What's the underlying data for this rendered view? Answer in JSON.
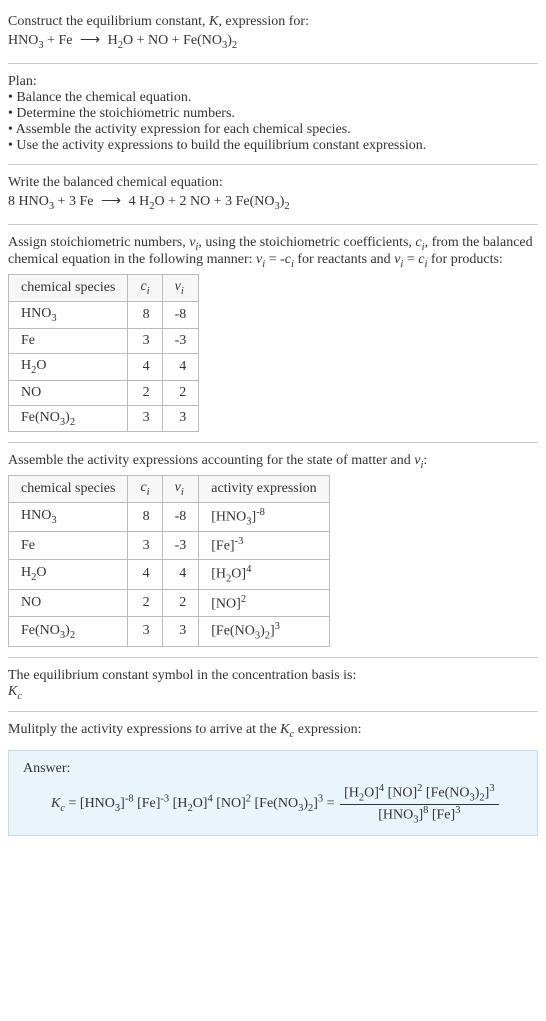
{
  "prompt": {
    "line1": "Construct the equilibrium constant, K, expression for:",
    "eq_lhs": "HNO₃ + Fe",
    "eq_rhs": "H₂O + NO + Fe(NO₃)₂"
  },
  "plan": {
    "title": "Plan:",
    "items": [
      "Balance the chemical equation.",
      "Determine the stoichiometric numbers.",
      "Assemble the activity expression for each chemical species.",
      "Use the activity expressions to build the equilibrium constant expression."
    ]
  },
  "balanced": {
    "title": "Write the balanced chemical equation:",
    "eq_lhs": "8 HNO₃ + 3 Fe",
    "eq_rhs": "4 H₂O + 2 NO + 3 Fe(NO₃)₂"
  },
  "stoich": {
    "intro": "Assign stoichiometric numbers, νᵢ, using the stoichiometric coefficients, cᵢ, from the balanced chemical equation in the following manner: νᵢ = -cᵢ for reactants and νᵢ = cᵢ for products:",
    "headers": [
      "chemical species",
      "cᵢ",
      "νᵢ"
    ],
    "rows": [
      {
        "species": "HNO₃",
        "ci": "8",
        "vi": "-8"
      },
      {
        "species": "Fe",
        "ci": "3",
        "vi": "-3"
      },
      {
        "species": "H₂O",
        "ci": "4",
        "vi": "4"
      },
      {
        "species": "NO",
        "ci": "2",
        "vi": "2"
      },
      {
        "species": "Fe(NO₃)₂",
        "ci": "3",
        "vi": "3"
      }
    ]
  },
  "activity": {
    "intro": "Assemble the activity expressions accounting for the state of matter and νᵢ:",
    "headers": [
      "chemical species",
      "cᵢ",
      "νᵢ",
      "activity expression"
    ],
    "rows": [
      {
        "species": "HNO₃",
        "ci": "8",
        "vi": "-8",
        "expr": "[HNO₃]⁻⁸"
      },
      {
        "species": "Fe",
        "ci": "3",
        "vi": "-3",
        "expr": "[Fe]⁻³"
      },
      {
        "species": "H₂O",
        "ci": "4",
        "vi": "4",
        "expr": "[H₂O]⁴"
      },
      {
        "species": "NO",
        "ci": "2",
        "vi": "2",
        "expr": "[NO]²"
      },
      {
        "species": "Fe(NO₃)₂",
        "ci": "3",
        "vi": "3",
        "expr": "[Fe(NO₃)₂]³"
      }
    ]
  },
  "basis": {
    "line1": "The equilibrium constant symbol in the concentration basis is:",
    "symbol": "K_c"
  },
  "multiply": {
    "line": "Mulitply the activity expressions to arrive at the K_c expression:"
  },
  "answer": {
    "label": "Answer:",
    "kc_prefix": "K_c = ",
    "flat": "[HNO₃]⁻⁸ [Fe]⁻³ [H₂O]⁴ [NO]² [Fe(NO₃)₂]³ = ",
    "frac_num": "[H₂O]⁴ [NO]² [Fe(NO₃)₂]³",
    "frac_den": "[HNO₃]⁸ [Fe]³"
  }
}
